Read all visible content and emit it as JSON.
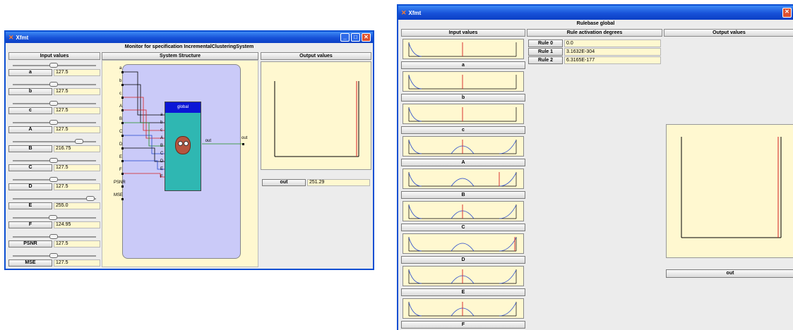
{
  "window1": {
    "app_title": "Xfmt",
    "header": "Monitor for specification IncrementalClusteringSystem",
    "input_col_title": "Input values",
    "structure_col_title": "System Structure",
    "output_col_title": "Output values",
    "inputs": [
      {
        "name": "a",
        "value": "127.5",
        "level": 0.5
      },
      {
        "name": "b",
        "value": "127.5",
        "level": 0.5
      },
      {
        "name": "c",
        "value": "127.5",
        "level": 0.5
      },
      {
        "name": "A",
        "value": "127.5",
        "level": 0.5
      },
      {
        "name": "B",
        "value": "216.75",
        "level": 0.85
      },
      {
        "name": "C",
        "value": "127.5",
        "level": 0.5
      },
      {
        "name": "D",
        "value": "127.5",
        "level": 0.5
      },
      {
        "name": "E",
        "value": "255.0",
        "level": 1.0
      },
      {
        "name": "F",
        "value": "124.95",
        "level": 0.49
      },
      {
        "name": "PSNR",
        "value": "127.5",
        "level": 0.5
      },
      {
        "name": "MSE",
        "value": "127.5",
        "level": 0.5
      }
    ],
    "structure": {
      "left_ports": [
        "a",
        "b",
        "c",
        "A",
        "B",
        "C",
        "D",
        "E",
        "F",
        "PSNR",
        "MSE"
      ],
      "module_title": "global",
      "module_ports": [
        "a",
        "b",
        "c",
        "A",
        "B",
        "C",
        "D",
        "E",
        "F"
      ],
      "module_out": "out",
      "right_port": "out"
    },
    "output_name": "out",
    "output_value": "251.29"
  },
  "window2": {
    "app_title": "Xfmt",
    "header": "Rulebase global",
    "input_col_title": "Input values",
    "rules_col_title": "Rule activation degrees",
    "output_col_title": "Output values",
    "mf_labels": [
      "a",
      "b",
      "c",
      "A",
      "B",
      "C",
      "D",
      "E",
      "F"
    ],
    "rules": [
      {
        "name": "Rule 0",
        "value": "0.0"
      },
      {
        "name": "Rule 1",
        "value": "3.1632E-304"
      },
      {
        "name": "Rule 2",
        "value": "6.3165E-177"
      }
    ],
    "output_name": "out"
  },
  "colors": {
    "title_blue": "#1751d8",
    "module_head": "#0b16d6",
    "module_body": "#2fb7b2",
    "structure_bg": "#cacaf8",
    "cream": "#fff8d0"
  }
}
